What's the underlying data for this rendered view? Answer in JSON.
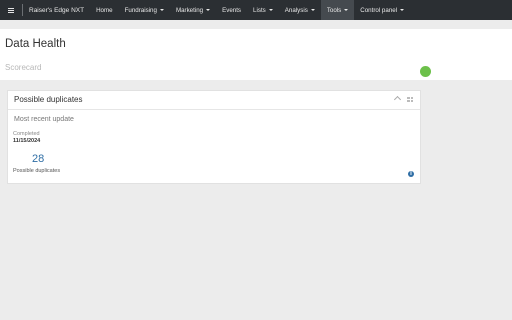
{
  "nav": {
    "brand": "Raiser's Edge NXT",
    "items": [
      {
        "label": "Home",
        "caret": false,
        "active": false
      },
      {
        "label": "Fundraising",
        "caret": true,
        "active": false
      },
      {
        "label": "Marketing",
        "caret": true,
        "active": false
      },
      {
        "label": "Events",
        "caret": false,
        "active": false
      },
      {
        "label": "Lists",
        "caret": true,
        "active": false
      },
      {
        "label": "Analysis",
        "caret": true,
        "active": false
      },
      {
        "label": "Tools",
        "caret": true,
        "active": true
      },
      {
        "label": "Control panel",
        "caret": true,
        "active": false
      }
    ]
  },
  "header": {
    "title": "Data Health",
    "subtitle": "Scorecard",
    "status_color": "#6cc04a"
  },
  "card": {
    "title": "Possible duplicates",
    "section_label": "Most recent update",
    "completed_label": "Completed",
    "completed_date": "11/15/2024",
    "count": "28",
    "count_label": "Possible duplicates",
    "info_glyph": "i"
  },
  "colors": {
    "nav_bg": "#2b2f33",
    "accent": "#2f6ea5"
  }
}
